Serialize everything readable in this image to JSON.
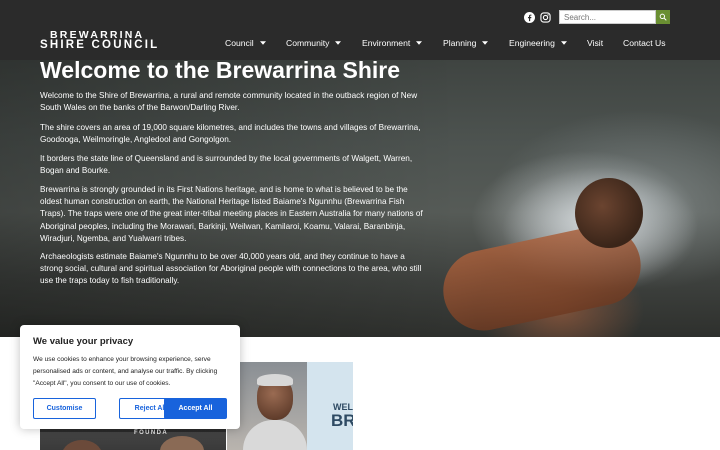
{
  "header": {
    "logo_line1": "BREWARRINA",
    "logo_line2": "SHIRE COUNCIL",
    "social": [
      "facebook-icon",
      "instagram-icon"
    ],
    "search": {
      "placeholder": "Search..."
    },
    "nav": [
      {
        "label": "Council",
        "dropdown": true
      },
      {
        "label": "Community",
        "dropdown": true
      },
      {
        "label": "Environment",
        "dropdown": true
      },
      {
        "label": "Planning",
        "dropdown": true
      },
      {
        "label": "Engineering",
        "dropdown": true
      },
      {
        "label": "Visit",
        "dropdown": false
      },
      {
        "label": "Contact Us",
        "dropdown": false
      }
    ],
    "colors": {
      "background": "#2b2b2b",
      "search_button": "#6a8f32"
    }
  },
  "hero": {
    "title": "Welcome to the Brewarrina Shire",
    "paragraphs": [
      "Welcome to the Shire of Brewarrina, a rural and remote community located in the outback region of New South Wales on the banks of the Barwon/Darling River.",
      "The shire covers an area of 19,000 square kilometres, and includes the towns and villages of Brewarrina, Goodooga, Weilmoringle, Angledool and Gongolgon.",
      "It borders the state line of Queensland and is surrounded by the local governments of Walgett, Warren, Bogan and Bourke.",
      "Brewarrina is strongly grounded in its First Nations heritage, and is home to what is believed to be the oldest human construction on earth, the National Heritage listed Baiame's Ngunnhu (Brewarrina Fish Traps). The traps were one of the great inter-tribal meeting places in Eastern Australia for many nations of Aboriginal peoples, including the Morawari, Barkinji, Weilwan, Kamilaroi, Koamu, Valarai, Baranbinja, Wiradjuri, Ngemba, and Yualwarri tribes.",
      "Archaeologists estimate Baiame's Ngunnhu to be over 40,000 years old, and they continue to have a strong social, cultural and spiritual association for Aboriginal people with connections to the area, who still use the traps today to fish traditionally."
    ]
  },
  "cards": {
    "photo_caption": "FOUNDA",
    "welcome_line1": "WEL",
    "welcome_line2": "BRE"
  },
  "cookie": {
    "title": "We value your privacy",
    "body": "We use cookies to enhance your browsing experience, serve personalised ads or content, and analyse our traffic. By clicking \"Accept All\", you consent to our use of cookies.",
    "customise": "Customise",
    "reject": "Reject All",
    "accept": "Accept All",
    "colors": {
      "accent": "#1863dc"
    }
  }
}
